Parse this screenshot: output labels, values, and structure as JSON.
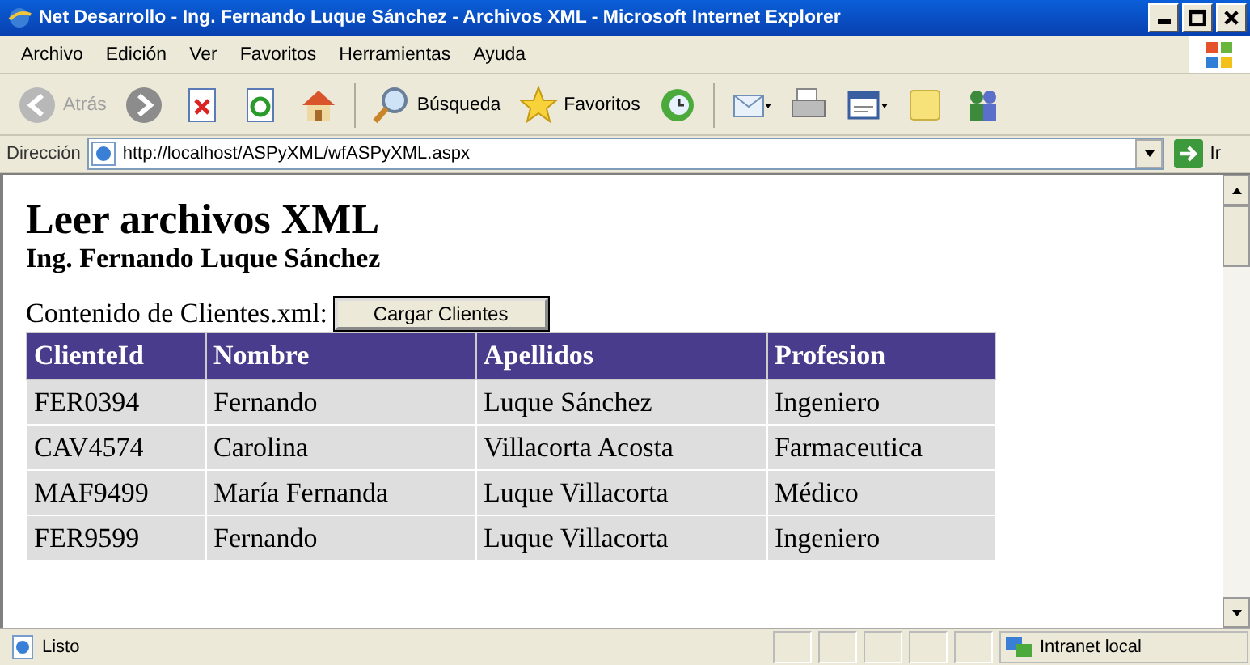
{
  "window": {
    "title": "Net Desarrollo - Ing. Fernando Luque Sánchez - Archivos XML - Microsoft Internet Explorer"
  },
  "menu": [
    "Archivo",
    "Edición",
    "Ver",
    "Favoritos",
    "Herramientas",
    "Ayuda"
  ],
  "toolbar": [
    {
      "kind": "back",
      "label": "Atrás",
      "disabled": true
    },
    {
      "kind": "forward",
      "disabled": false
    },
    {
      "kind": "stop"
    },
    {
      "kind": "refresh"
    },
    {
      "kind": "home"
    },
    {
      "kind": "search",
      "label": "Búsqueda"
    },
    {
      "kind": "favorites",
      "label": "Favoritos"
    },
    {
      "kind": "history"
    },
    {
      "kind": "mail"
    },
    {
      "kind": "print"
    },
    {
      "kind": "edit"
    },
    {
      "kind": "note"
    },
    {
      "kind": "messenger"
    }
  ],
  "address": {
    "label": "Dirección",
    "url": "http://localhost/ASPyXML/wfASPyXML.aspx",
    "go": "Ir"
  },
  "page": {
    "heading": "Leer archivos XML",
    "subheading": "Ing. Fernando Luque Sánchez",
    "label": "Contenido de Clientes.xml:",
    "button": "Cargar Clientes"
  },
  "table": {
    "columns": [
      "ClienteId",
      "Nombre",
      "Apellidos",
      "Profesion"
    ],
    "rows": [
      [
        "FER0394",
        "Fernando",
        "Luque Sánchez",
        "Ingeniero"
      ],
      [
        "CAV4574",
        "Carolina",
        "Villacorta Acosta",
        "Farmaceutica"
      ],
      [
        "MAF9499",
        "María Fernanda",
        "Luque Villacorta",
        "Médico"
      ],
      [
        "FER9599",
        "Fernando",
        "Luque Villacorta",
        "Ingeniero"
      ]
    ]
  },
  "status_bar": {
    "text": "Listo",
    "zone": "Intranet local"
  }
}
